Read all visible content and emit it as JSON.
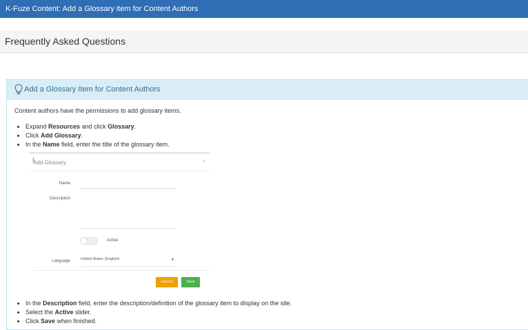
{
  "topbar": {
    "title": "K-Fuze Content: Add a Glossary item for Content Authors"
  },
  "faq": {
    "title": "Frequently Asked Questions"
  },
  "panel": {
    "title": "Add a Glossary Item for Content Authors",
    "intro": "Content authors have the permissions to add glossary items.",
    "steps_before": [
      {
        "pre": "Expand ",
        "b1": "Resources",
        "mid": " and click ",
        "b2": "Glossary",
        "post": "."
      },
      {
        "pre": "Click ",
        "b1": "Add Glossary",
        "mid": "",
        "b2": "",
        "post": "."
      },
      {
        "pre": "In the ",
        "b1": "Name",
        "mid": " field, enter the title of the glossary item.",
        "b2": "",
        "post": ""
      }
    ],
    "steps_after": [
      {
        "pre": "In the ",
        "b1": "Description",
        "mid": " field, enter the description/definition of the glossary item to display on the site.",
        "b2": "",
        "post": ""
      },
      {
        "pre": "Select the ",
        "b1": "Active",
        "mid": " slider.",
        "b2": "",
        "post": ""
      },
      {
        "pre": "Click ",
        "b1": "Save",
        "mid": " when finished.",
        "b2": "",
        "post": ""
      }
    ]
  },
  "dialog": {
    "title": "Add Glossary",
    "close": "×",
    "name_label": "Name",
    "description_label": "Description",
    "active_label": "Active",
    "language_label": "Language",
    "language_value": "United States (English)",
    "cancel_label": "Cancel",
    "save_label": "Save"
  },
  "colors": {
    "topbar": "#2f6db5",
    "panel_heading": "#d9edf7",
    "panel_title": "#31708f",
    "cancel": "#f0a000",
    "save": "#4cae4c"
  }
}
